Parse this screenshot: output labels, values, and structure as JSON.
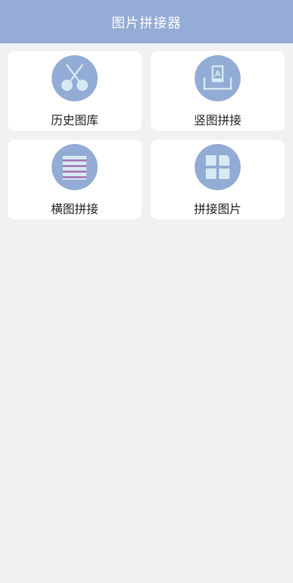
{
  "header": {
    "title": "图片拼接器"
  },
  "menu": {
    "items": [
      {
        "label": "历史图库",
        "icon": "scissors-icon"
      },
      {
        "label": "竖图拼接",
        "icon": "portrait-frame-icon"
      },
      {
        "label": "横图拼接",
        "icon": "stacked-bars-icon"
      },
      {
        "label": "拼接图片",
        "icon": "grid-tiles-icon"
      }
    ]
  },
  "colors": {
    "header_bg": "#94acd6",
    "icon_circle": "#93acd5",
    "icon_fill": "#d7eaf3",
    "accent_purple": "#a77bb8",
    "page_bg": "#f1f1f4"
  }
}
